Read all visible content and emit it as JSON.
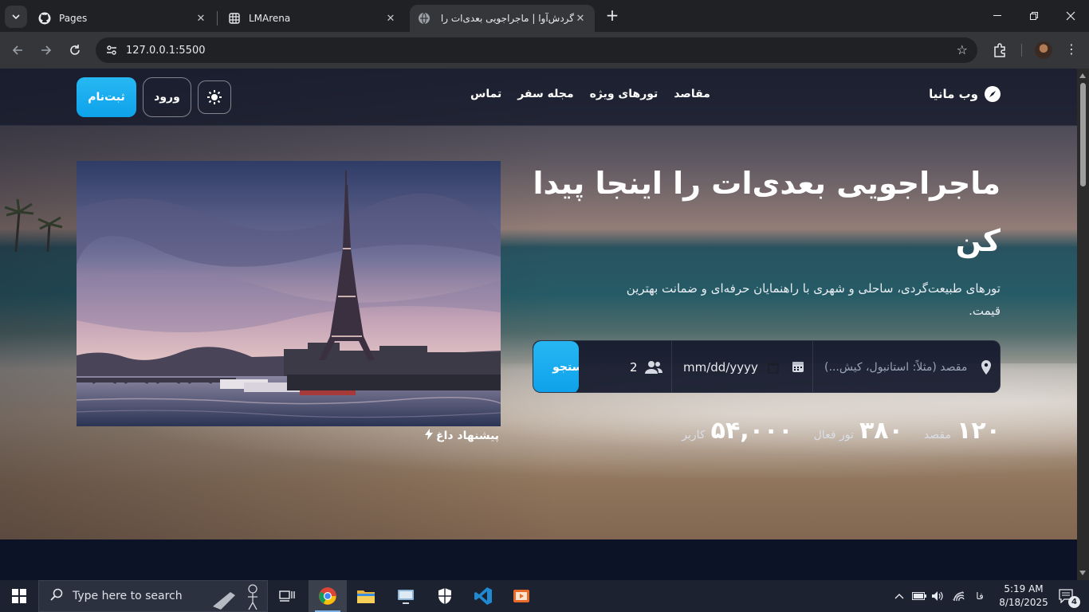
{
  "browser": {
    "tabs": [
      {
        "title": "Pages",
        "icon": "github-icon"
      },
      {
        "title": "LMArena",
        "icon": "grid-icon"
      },
      {
        "title": "گردش‌آوا | ماجراجویی بعدی‌ات را پ",
        "icon": "globe-icon",
        "active": true
      }
    ],
    "url": "127.0.0.1:5500"
  },
  "site": {
    "brand": "وب مانیا",
    "nav": [
      "مقاصد",
      "تورهای ویژه",
      "مجله سفر",
      "تماس"
    ],
    "login_label": "ورود",
    "signup_label": "ثبت‌نام",
    "hero": {
      "title": "ماجراجویی بعدی‌ات را اینجا پیدا کن",
      "subtitle": "تورهای طبیعت‌گردی، ساحلی و شهری با راهنمایان حرفه‌ای و ضمانت بهترین قیمت."
    },
    "search": {
      "destination_placeholder": "مقصد (مثلاً: استانبول، کیش...)",
      "date_value": "mm/dd/yyyy",
      "passengers": "2",
      "button_label": "جستجو"
    },
    "stats": [
      {
        "value": "۱۲۰",
        "label": "مقصد"
      },
      {
        "value": "۳۸۰",
        "label": "تور فعال"
      },
      {
        "value": "۵۴,۰۰۰",
        "label": "کاربر"
      }
    ],
    "hot_offer_label": "پیشنهاد داغ"
  },
  "taskbar": {
    "search_placeholder": "Type here to search",
    "language": "فا",
    "time": "5:19 AM",
    "date": "8/18/2025",
    "notifications": "4"
  },
  "colors": {
    "accent": "#0ea5e9",
    "page_bg": "#0d1326"
  }
}
